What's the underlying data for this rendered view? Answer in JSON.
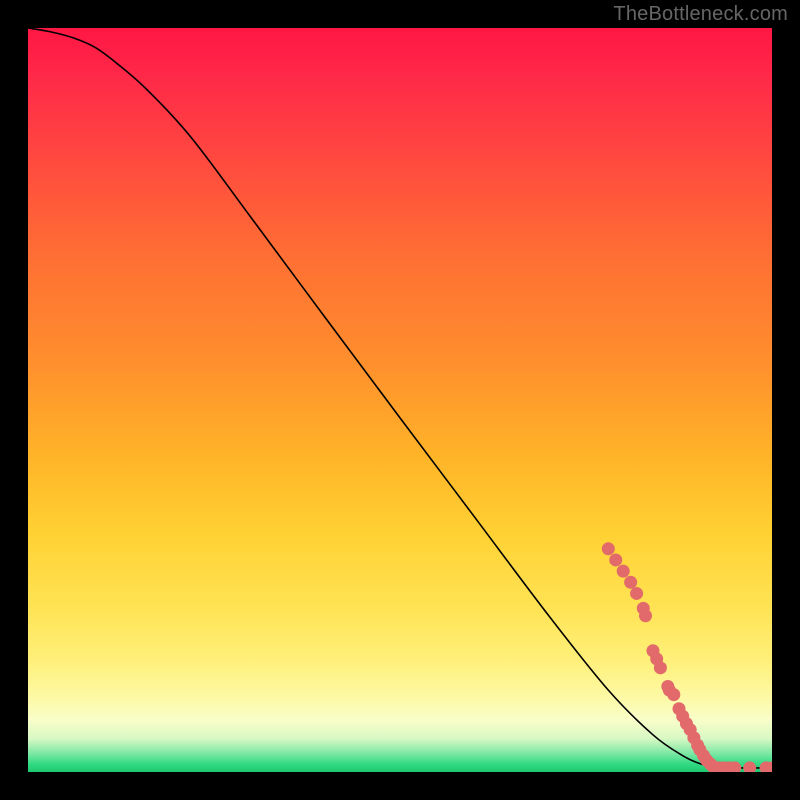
{
  "watermark": "TheBottleneck.com",
  "chart_data": {
    "type": "line",
    "title": "",
    "xlabel": "",
    "ylabel": "",
    "xlim": [
      0,
      100
    ],
    "ylim": [
      0,
      100
    ],
    "grid": false,
    "legend": false,
    "background_gradient": {
      "stops": [
        {
          "offset": 0.0,
          "color": "#ff1744"
        },
        {
          "offset": 0.07,
          "color": "#ff2a48"
        },
        {
          "offset": 0.18,
          "color": "#ff4a3f"
        },
        {
          "offset": 0.3,
          "color": "#ff6d34"
        },
        {
          "offset": 0.45,
          "color": "#ff8f2d"
        },
        {
          "offset": 0.58,
          "color": "#ffb528"
        },
        {
          "offset": 0.68,
          "color": "#ffd133"
        },
        {
          "offset": 0.78,
          "color": "#ffe354"
        },
        {
          "offset": 0.85,
          "color": "#fff07a"
        },
        {
          "offset": 0.9,
          "color": "#fdf9a5"
        },
        {
          "offset": 0.93,
          "color": "#f9fec9"
        },
        {
          "offset": 0.955,
          "color": "#d8f8c4"
        },
        {
          "offset": 0.975,
          "color": "#7de8a4"
        },
        {
          "offset": 0.99,
          "color": "#2ed982"
        },
        {
          "offset": 1.0,
          "color": "#1fc96f"
        }
      ]
    },
    "series": [
      {
        "name": "curve",
        "color": "#000000",
        "stroke_width": 1.6,
        "x": [
          0,
          3,
          6,
          9,
          12,
          16,
          22,
          30,
          40,
          50,
          60,
          70,
          78,
          84,
          88,
          90.5,
          92,
          94,
          96,
          98,
          100
        ],
        "y": [
          100,
          99.5,
          98.7,
          97.4,
          95.2,
          91.7,
          85.2,
          74.5,
          61.0,
          47.6,
          34.3,
          21.0,
          11.0,
          5.0,
          2.2,
          1.05,
          0.65,
          0.55,
          0.55,
          0.55,
          0.55
        ]
      }
    ],
    "scatter": {
      "name": "markers",
      "color": "#e36a6a",
      "radius": 6.5,
      "points": [
        {
          "x": 78.0,
          "y": 30.0
        },
        {
          "x": 79.0,
          "y": 28.5
        },
        {
          "x": 80.0,
          "y": 27.0
        },
        {
          "x": 81.0,
          "y": 25.5
        },
        {
          "x": 81.8,
          "y": 24.0
        },
        {
          "x": 82.7,
          "y": 22.0
        },
        {
          "x": 83.0,
          "y": 21.0
        },
        {
          "x": 84.0,
          "y": 16.3
        },
        {
          "x": 84.5,
          "y": 15.2
        },
        {
          "x": 85.0,
          "y": 14.0
        },
        {
          "x": 86.0,
          "y": 11.5
        },
        {
          "x": 86.2,
          "y": 11.0
        },
        {
          "x": 86.8,
          "y": 10.4
        },
        {
          "x": 87.5,
          "y": 8.5
        },
        {
          "x": 88.0,
          "y": 7.5
        },
        {
          "x": 88.5,
          "y": 6.5
        },
        {
          "x": 89.0,
          "y": 5.7
        },
        {
          "x": 89.5,
          "y": 4.6
        },
        {
          "x": 90.0,
          "y": 3.6
        },
        {
          "x": 90.3,
          "y": 3.0
        },
        {
          "x": 90.8,
          "y": 2.2
        },
        {
          "x": 91.2,
          "y": 1.6
        },
        {
          "x": 91.7,
          "y": 1.1
        },
        {
          "x": 92.0,
          "y": 0.8
        },
        {
          "x": 92.5,
          "y": 0.55
        },
        {
          "x": 93.0,
          "y": 0.55
        },
        {
          "x": 93.6,
          "y": 0.55
        },
        {
          "x": 94.3,
          "y": 0.55
        },
        {
          "x": 95.0,
          "y": 0.55
        },
        {
          "x": 97.0,
          "y": 0.55
        },
        {
          "x": 99.2,
          "y": 0.55
        },
        {
          "x": 100.0,
          "y": 0.55
        }
      ]
    }
  }
}
